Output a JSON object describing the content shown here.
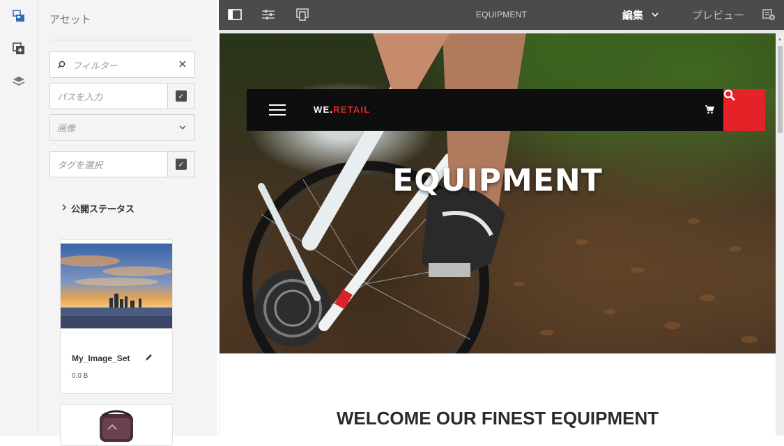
{
  "rail": {
    "items": [
      {
        "name": "assets-icon",
        "active": true
      },
      {
        "name": "components-icon",
        "active": false
      },
      {
        "name": "content-tree-icon",
        "active": false
      }
    ]
  },
  "panel": {
    "title": "アセット",
    "filter": {
      "placeholder": "フィルター"
    },
    "path": {
      "placeholder": "パスを入力"
    },
    "asset_type": {
      "value": "画像"
    },
    "tags": {
      "placeholder": "タグを選択"
    },
    "publish_status_label": "公開ステータス",
    "cards": [
      {
        "name": "My_Image_Set",
        "size": "0.0 B"
      }
    ]
  },
  "topbar": {
    "page_title": "EQUIPMENT",
    "mode_label": "編集",
    "preview_label": "プレビュー"
  },
  "page": {
    "logo_prefix": "WE.",
    "logo_suffix": "RETAIL",
    "hero_title": "EQUIPMENT",
    "welcome_heading": "WELCOME OUR FINEST EQUIPMENT"
  },
  "colors": {
    "accent_red": "#e62229",
    "topbar_bg": "#4b4b4b",
    "rail_active_icon": "#2b6fb6"
  }
}
